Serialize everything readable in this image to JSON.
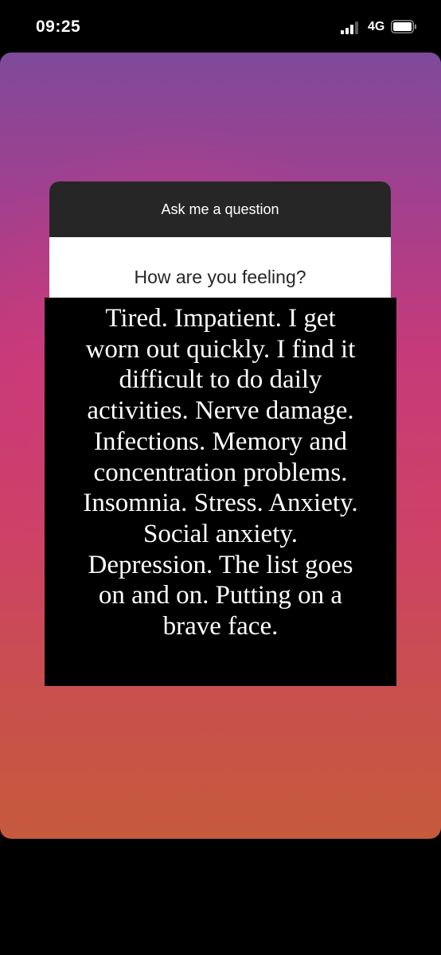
{
  "status_bar": {
    "time": "09:25",
    "network": "4G",
    "signal_icon": "cellular-signal-icon",
    "battery_icon": "battery-icon"
  },
  "story": {
    "background_colors": [
      "#7e4a9a",
      "#c63a7a",
      "#c55a3c"
    ],
    "question_sticker": {
      "header": "Ask me a question",
      "question": "How are you feeling?"
    },
    "answer_lines": [
      "Tired. Impatient. I get",
      "worn out quickly. I find it",
      "difficult to do daily",
      "activities. Nerve damage.",
      "Infections. Memory and",
      "concentration problems.",
      "Insomnia. Stress. Anxiety.",
      "Social anxiety.",
      "Depression. The list goes",
      "on and on. Putting on a",
      "brave face."
    ]
  }
}
